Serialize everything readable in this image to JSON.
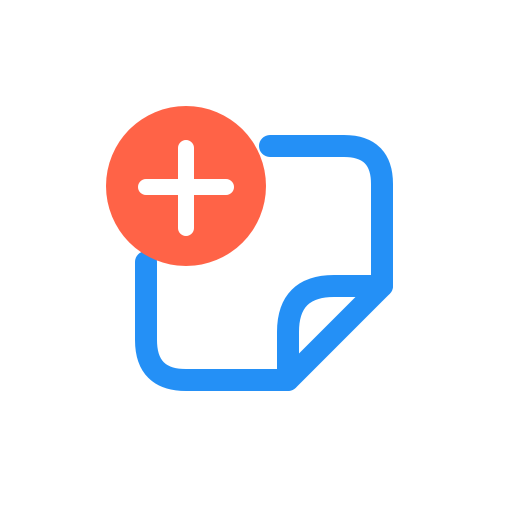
{
  "icon": {
    "name": "add-note-icon",
    "parts": [
      "sticky-note-icon",
      "plus-badge-icon"
    ]
  },
  "colors": {
    "background": "#FFFFFF",
    "note_outline": "#2490F6",
    "badge_fill": "#FF6347",
    "badge_plus": "#FFFFFF"
  }
}
